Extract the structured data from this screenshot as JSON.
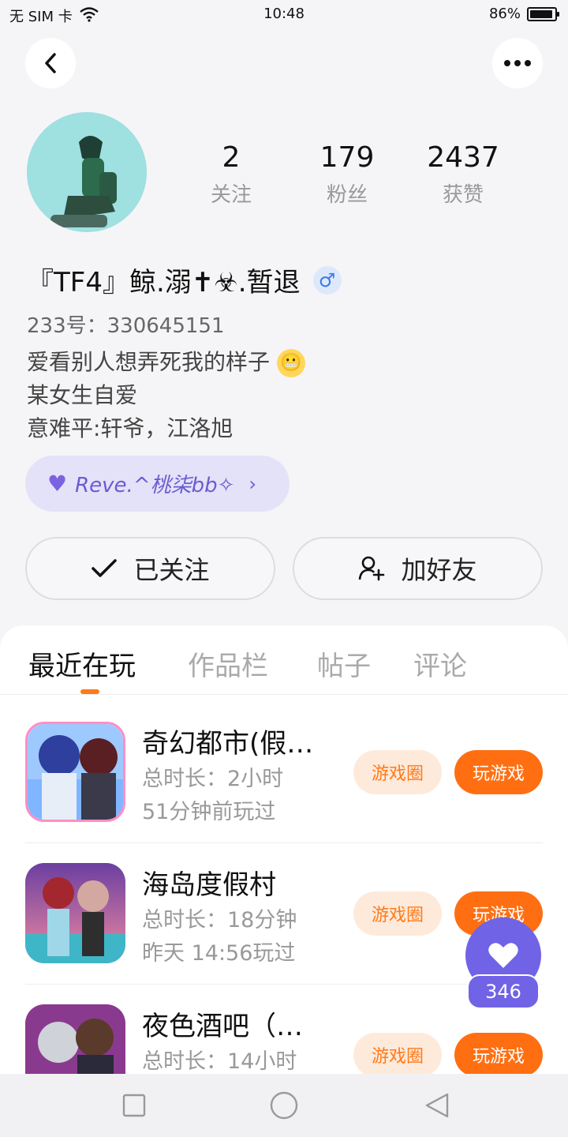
{
  "status_bar": {
    "carrier": "无 SIM 卡",
    "time": "10:48",
    "battery": "86%",
    "battery_level": 0.86
  },
  "header": {
    "back_icon": "back-arrow-icon",
    "more_icon": "more-dots-icon"
  },
  "stats": [
    {
      "value": "2",
      "label": "关注"
    },
    {
      "value": "179",
      "label": "粉丝"
    },
    {
      "value": "2437",
      "label": "获赞"
    }
  ],
  "profile": {
    "nickname": "『TF4』鲸.溺✝☣.暂退",
    "gender_symbol": "♂",
    "id_line": "233号：330645151",
    "bio_lines": [
      "爱看别人想弄死我的样子",
      "某女生自爱",
      "意难平:轩爷，江洛旭"
    ],
    "family": "Reve.^桃柒bb✧"
  },
  "actions": {
    "follow_label": "已关注",
    "add_friend_label": "加好友"
  },
  "tabs": [
    {
      "label": "最近在玩"
    },
    {
      "label": "作品栏"
    },
    {
      "label": "帖子"
    },
    {
      "label": "评论"
    }
  ],
  "games": [
    {
      "name": "奇幻都市(假…",
      "duration": "总时长：2小时",
      "last_played": "51分钟前玩过",
      "circle_label": "游戏圈",
      "play_label": "玩游戏"
    },
    {
      "name": "海岛度假村",
      "duration": "总时长：18分钟",
      "last_played": "昨天 14:56玩过",
      "circle_label": "游戏圈",
      "play_label": "玩游戏"
    },
    {
      "name": "夜色酒吧（…",
      "duration": "总时长：14小时",
      "last_played": "",
      "circle_label": "游戏圈",
      "play_label": "玩游戏"
    }
  ],
  "like": {
    "count": "346"
  },
  "colors": {
    "accent": "#ff6f12",
    "family_purple": "#6b5bd0",
    "like_purple": "#7063e6"
  }
}
